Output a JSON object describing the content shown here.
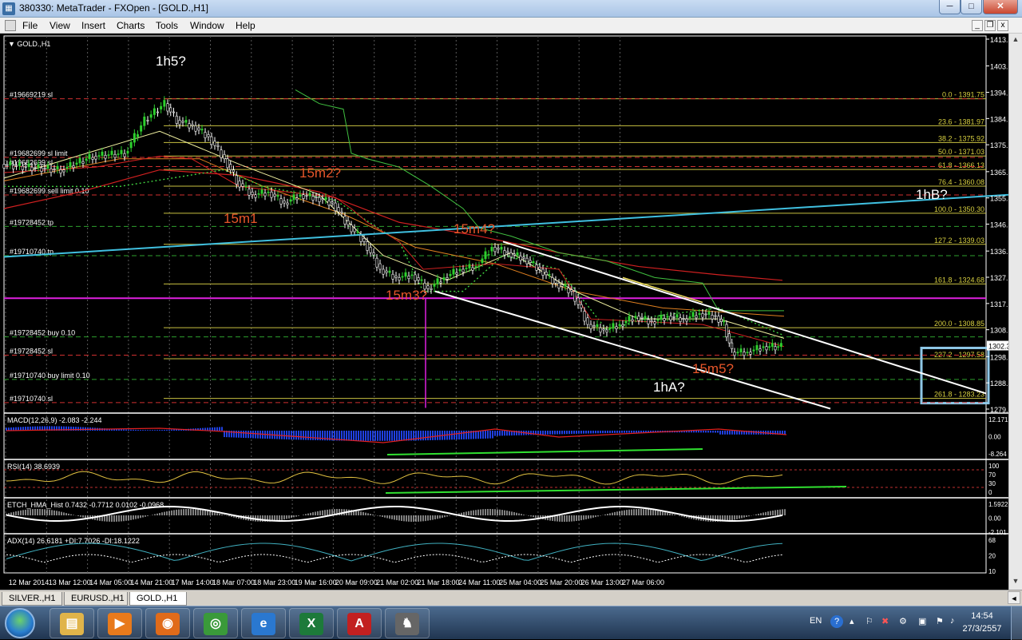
{
  "window": {
    "title": "380330: MetaTrader - FXOpen - [GOLD.,H1]",
    "minimize": "─",
    "maximize": "□",
    "close": "✕"
  },
  "menu": [
    "File",
    "View",
    "Insert",
    "Charts",
    "Tools",
    "Window",
    "Help"
  ],
  "mdi": {
    "minimize": "_",
    "restore": "❐",
    "close": "x"
  },
  "chart": {
    "symbol_label": "▼ GOLD.,H1",
    "price_levels": [
      {
        "label": "1413.35",
        "y": 1413.35
      },
      {
        "label": "1403.65",
        "y": 1403.65
      },
      {
        "label": "1394.10",
        "y": 1394.1
      },
      {
        "label": "1384.60",
        "y": 1384.6
      },
      {
        "label": "1375.10",
        "y": 1375.1
      },
      {
        "label": "1365.35",
        "y": 1365.35
      },
      {
        "label": "1355.85",
        "y": 1355.85
      },
      {
        "label": "1346.35",
        "y": 1346.35
      },
      {
        "label": "1336.60",
        "y": 1336.6
      },
      {
        "label": "1327.10",
        "y": 1327.1
      },
      {
        "label": "1317.60",
        "y": 1317.6
      },
      {
        "label": "1308.10",
        "y": 1308.1
      },
      {
        "label": "1298.35",
        "y": 1298.35
      },
      {
        "label": "1288.85",
        "y": 1288.85
      },
      {
        "label": "1279.35",
        "y": 1279.35
      }
    ],
    "current_price": "1302.35",
    "fib_levels": [
      {
        "label": "0.0 - 1391.75",
        "price": 1391.75
      },
      {
        "label": "23.6 - 1381.97",
        "price": 1381.97
      },
      {
        "label": "38.2 - 1375.92",
        "price": 1375.92
      },
      {
        "label": "50.0 - 1371.03",
        "price": 1371.03
      },
      {
        "label": "61.8 - 1366.13",
        "price": 1366.13
      },
      {
        "label": "76.4 - 1360.08",
        "price": 1360.08
      },
      {
        "label": "100.0 - 1350.30",
        "price": 1350.3
      },
      {
        "label": "127.2 - 1339.03",
        "price": 1339.03
      },
      {
        "label": "161.8 - 1324.68",
        "price": 1324.68
      },
      {
        "label": "200.0 - 1308.85",
        "price": 1308.85
      },
      {
        "label": "227.2 - 1297.58",
        "price": 1297.58
      },
      {
        "label": "261.8 - 1283.23",
        "price": 1283.23
      }
    ],
    "order_labels": [
      {
        "text": "#19669219 sl",
        "price": 1391.75
      },
      {
        "text": "#19682699 sl limit",
        "price": 1370.5
      },
      {
        "text": "#19682699 sl",
        "price": 1367.2
      },
      {
        "text": "#19682699 sell limit 0.10",
        "price": 1356.9
      },
      {
        "text": "#19728452 tp",
        "price": 1345.5
      },
      {
        "text": "#19710740 tp",
        "price": 1334.9
      },
      {
        "text": "#19728452 buy 0.10",
        "price": 1305.5
      },
      {
        "text": "#19728452 sl",
        "price": 1298.9
      },
      {
        "text": "#19710740 buy limit 0.10",
        "price": 1290.1
      },
      {
        "text": "#19710740 sl",
        "price": 1281.7
      }
    ],
    "wave_labels": [
      {
        "text": "1h5?",
        "color": "#ffffff"
      },
      {
        "text": "15m2?",
        "color": "#e8562a"
      },
      {
        "text": "15m1",
        "color": "#e8562a"
      },
      {
        "text": "15m4?",
        "color": "#e8562a"
      },
      {
        "text": "15m3?",
        "color": "#e8562a"
      },
      {
        "text": "1hB?",
        "color": "#ffffff"
      },
      {
        "text": "15m5?",
        "color": "#e8562a"
      },
      {
        "text": "1hA?",
        "color": "#ffffff"
      }
    ],
    "time_labels": [
      "12 Mar 2014",
      "13 Mar 12:00",
      "14 Mar 05:00",
      "14 Mar 21:00",
      "17 Mar 14:00",
      "18 Mar 07:00",
      "18 Mar 23:00",
      "19 Mar 16:00",
      "20 Mar 09:00",
      "21 Mar 02:00",
      "21 Mar 18:00",
      "24 Mar 11:00",
      "25 Mar 04:00",
      "25 Mar 20:00",
      "26 Mar 13:00",
      "27 Mar 06:00"
    ]
  },
  "indicators": {
    "macd": {
      "label": "MACD(12,26,9) -2.083 -2.244",
      "scale": [
        "12.1712",
        "0.00",
        "-8.264"
      ]
    },
    "rsi": {
      "label": "RSI(14) 38.6939",
      "scale": [
        "100",
        "70",
        "30",
        "0"
      ]
    },
    "stoch": {
      "label": "ETCH_HMA_Hist 0.7432 -0.7712 0.0102 -0.0968",
      "scale": [
        "1.5922",
        "0.00",
        "-2.101"
      ]
    },
    "adx": {
      "label": "ADX(14) 26.6181 +DI:7.7026 -DI:18.1222",
      "scale": [
        "68",
        "20",
        "10"
      ]
    }
  },
  "symbol_tabs": [
    "SILVER.,H1",
    "EURUSD.,H1",
    "GOLD.,H1"
  ],
  "taskbar": {
    "apps": [
      {
        "name": "folder",
        "glyph": "▤",
        "color": "#e0b44a"
      },
      {
        "name": "media",
        "glyph": "▶",
        "color": "#e87a1c"
      },
      {
        "name": "firefox",
        "glyph": "◉",
        "color": "#e06b1a"
      },
      {
        "name": "chrome",
        "glyph": "◎",
        "color": "#3a9a3a"
      },
      {
        "name": "ie",
        "glyph": "e",
        "color": "#2a78d0"
      },
      {
        "name": "excel",
        "glyph": "X",
        "color": "#1d7a3a"
      },
      {
        "name": "pdf",
        "glyph": "A",
        "color": "#c22020"
      },
      {
        "name": "metatrader",
        "glyph": "♞",
        "color": "#666"
      }
    ],
    "lang": "EN",
    "time": "14:54",
    "date": "27/3/2557"
  }
}
